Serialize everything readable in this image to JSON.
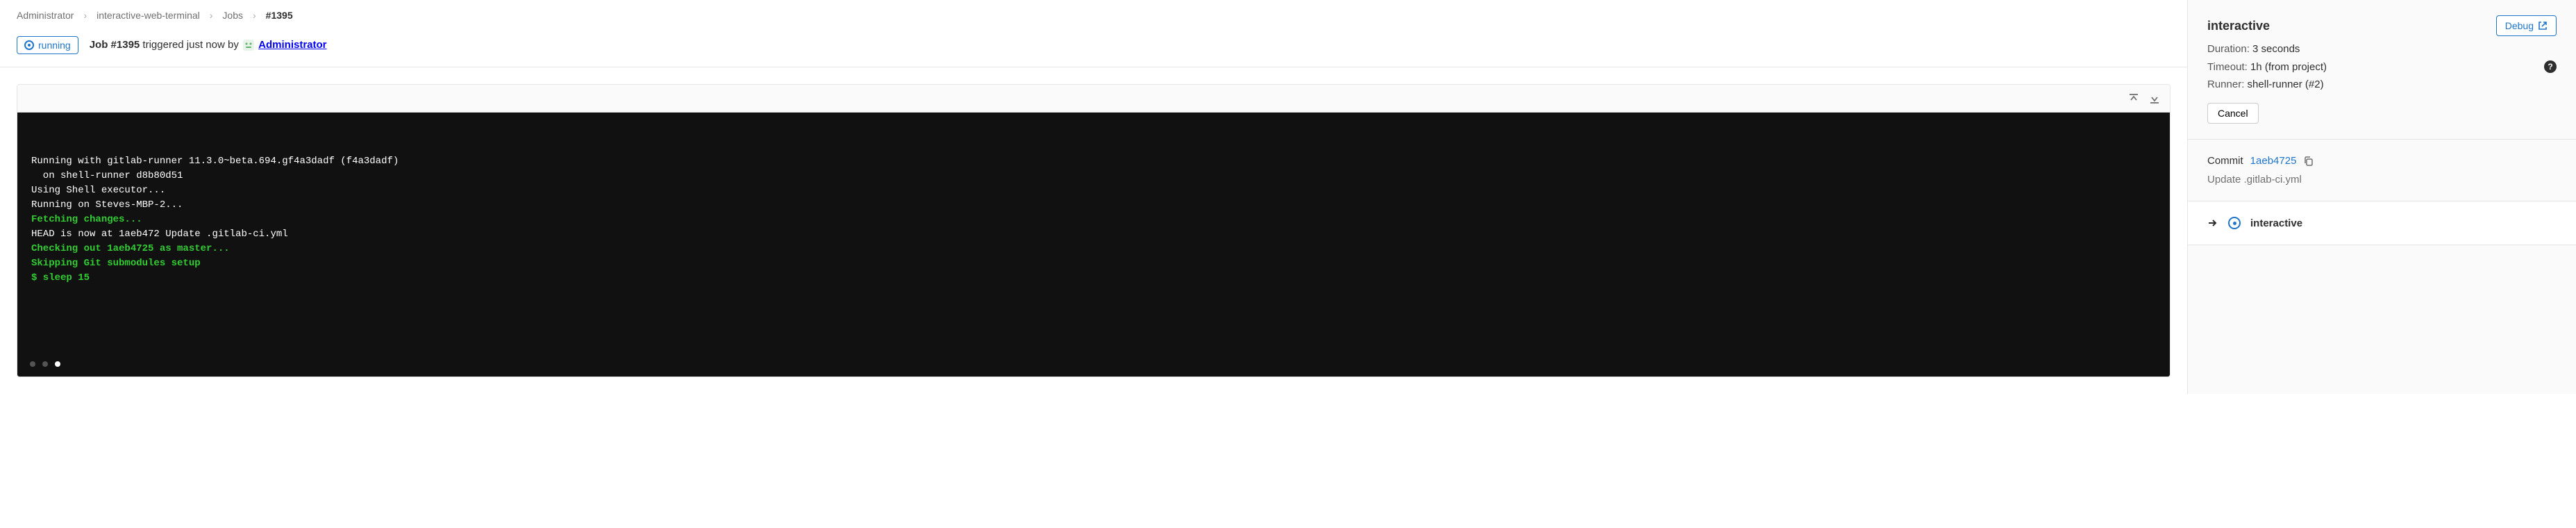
{
  "breadcrumbs": {
    "root": "Administrator",
    "project": "interactive-web-terminal",
    "section": "Jobs",
    "current": "#1395"
  },
  "header": {
    "status": "running",
    "job_label": "Job #1395",
    "triggered_text": "triggered just now by",
    "author": "Administrator"
  },
  "log": {
    "lines": [
      {
        "text": "Running with gitlab-runner 11.3.0~beta.694.gf4a3dadf (f4a3dadf)",
        "cls": ""
      },
      {
        "text": "  on shell-runner d8b80d51",
        "cls": ""
      },
      {
        "text": "Using Shell executor...",
        "cls": ""
      },
      {
        "text": "Running on Steves-MBP-2...",
        "cls": ""
      },
      {
        "text": "Fetching changes...",
        "cls": "green"
      },
      {
        "text": "HEAD is now at 1aeb472 Update .gitlab-ci.yml",
        "cls": ""
      },
      {
        "text": "Checking out 1aeb4725 as master...",
        "cls": "green"
      },
      {
        "text": "Skipping Git submodules setup",
        "cls": "green"
      },
      {
        "text": "$ sleep 15",
        "cls": "green"
      }
    ]
  },
  "sidebar": {
    "title": "interactive",
    "debug_label": "Debug",
    "duration_label": "Duration:",
    "duration_value": "3 seconds",
    "timeout_label": "Timeout:",
    "timeout_value": "1h (from project)",
    "runner_label": "Runner:",
    "runner_value": "shell-runner (#2)",
    "cancel_label": "Cancel",
    "commit_label": "Commit",
    "commit_sha": "1aeb4725",
    "commit_msg": "Update .gitlab-ci.yml",
    "stage_name": "interactive"
  }
}
